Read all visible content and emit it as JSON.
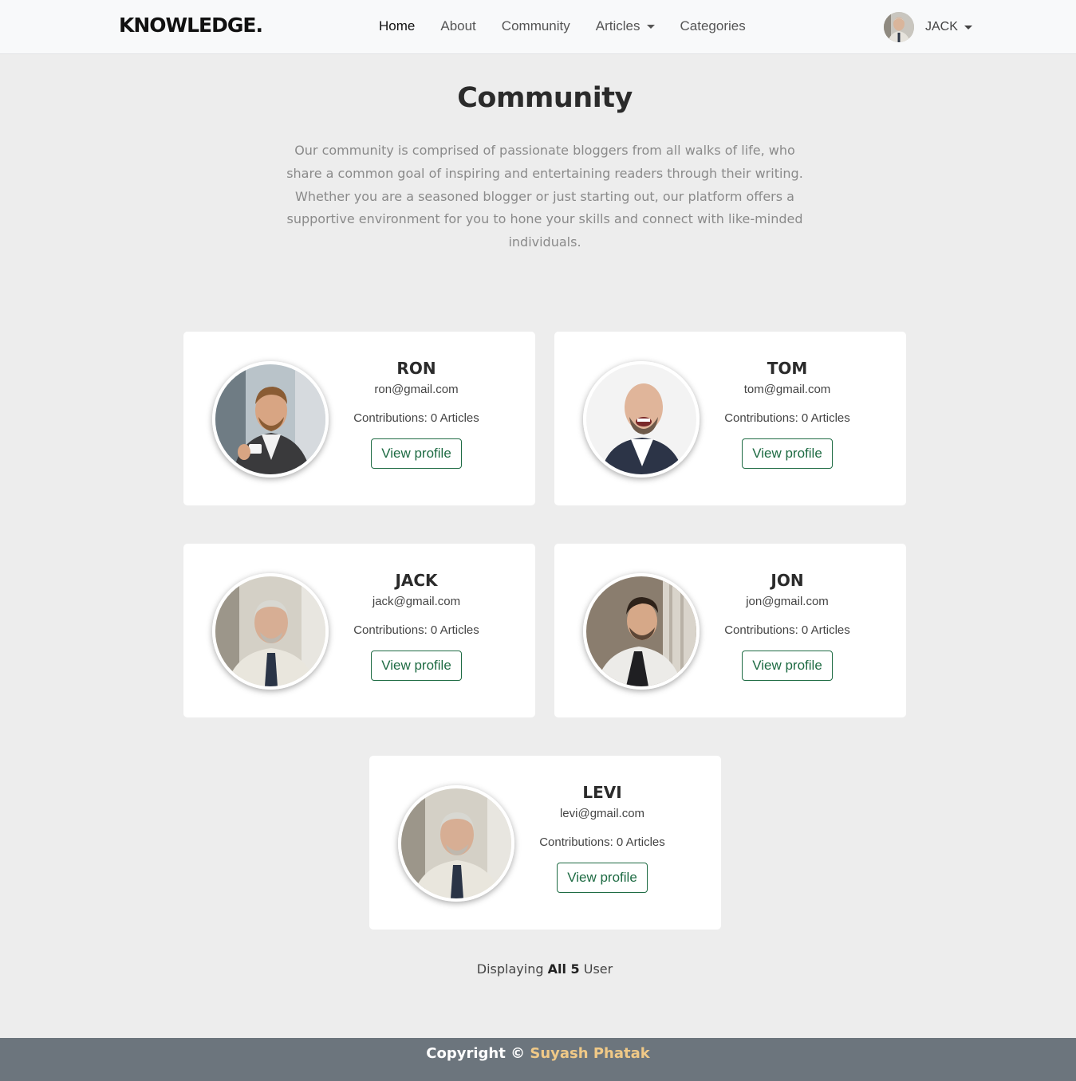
{
  "brand": "KNOWLEDGE.",
  "nav": {
    "home": "Home",
    "about": "About",
    "community": "Community",
    "articles": "Articles",
    "categories": "Categories"
  },
  "user": {
    "name": "JACK"
  },
  "page": {
    "title": "Community",
    "intro": "Our community is comprised of passionate bloggers from all walks of life, who share a common goal of inspiring and entertaining readers through their writing. Whether you are a seasoned blogger or just starting out, our platform offers a supportive environment for you to hone your skills and connect with like-minded individuals."
  },
  "members": [
    {
      "name": "RON",
      "email": "ron@gmail.com",
      "contributions": "Contributions: 0 Articles",
      "button": "View profile"
    },
    {
      "name": "TOM",
      "email": "tom@gmail.com",
      "contributions": "Contributions: 0 Articles",
      "button": "View profile"
    },
    {
      "name": "JACK",
      "email": "jack@gmail.com",
      "contributions": "Contributions: 0 Articles",
      "button": "View profile"
    },
    {
      "name": "JON",
      "email": "jon@gmail.com",
      "contributions": "Contributions: 0 Articles",
      "button": "View profile"
    },
    {
      "name": "LEVI",
      "email": "levi@gmail.com",
      "contributions": "Contributions: 0 Articles",
      "button": "View profile"
    }
  ],
  "summary": {
    "prefix": "Displaying",
    "strong": "All 5",
    "suffix": "User"
  },
  "footer": {
    "copyright": "Copyright ©",
    "author": "Suyash Phatak"
  },
  "colors": {
    "accent": "#1e6b43",
    "footer_bg": "#6c757d",
    "author": "#f0c987"
  }
}
